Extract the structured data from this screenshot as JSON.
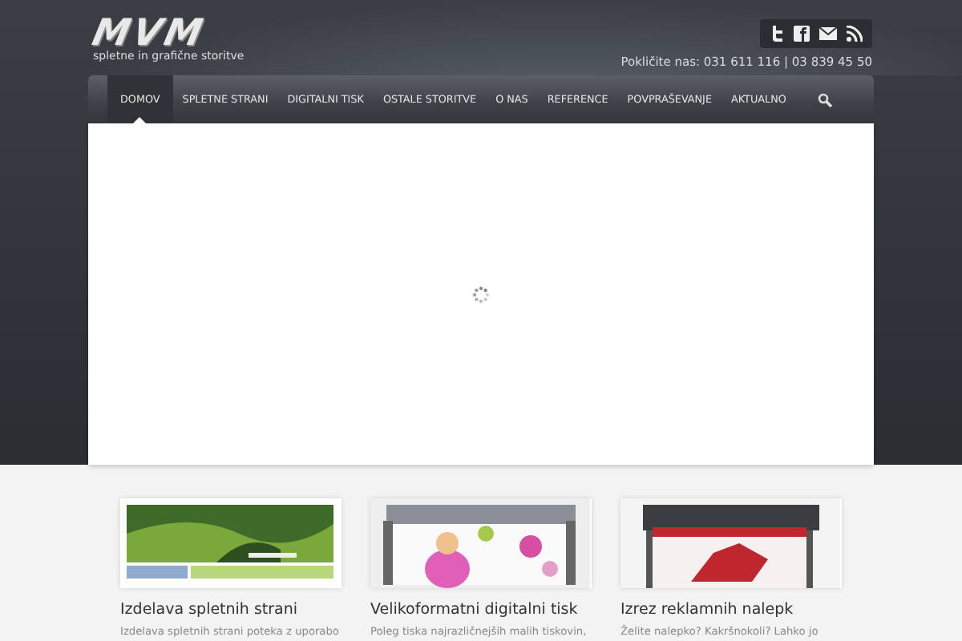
{
  "logo": {
    "text": "MVM",
    "tagline": "spletne in grafične storitve"
  },
  "contact": "Pokličite nas: 031 611 116 | 03 839 45 50",
  "nav": [
    {
      "label": "DOMOV",
      "selected": true
    },
    {
      "label": "SPLETNE STRANI",
      "selected": false
    },
    {
      "label": "DIGITALNI TISK",
      "selected": false
    },
    {
      "label": "OSTALE STORITVE",
      "selected": false
    },
    {
      "label": "O NAS",
      "selected": false
    },
    {
      "label": "REFERENCE",
      "selected": false
    },
    {
      "label": "POVPRAŠEVANJE",
      "selected": false
    },
    {
      "label": "AKTUALNO",
      "selected": false
    }
  ],
  "cards": [
    {
      "title": "Izdelava spletnih strani",
      "text": "Izdelava spletnih strani poteka z uporabo",
      "kind": "picture"
    },
    {
      "title": "Velikoformatni digitalni tisk",
      "text": "Poleg tiska najrazličnejših malih tiskovin,",
      "kind": "picture"
    },
    {
      "title": "Izrez reklamnih nalepk",
      "text": "Želite nalepko? Kakršnokoli? Lahko jo",
      "kind": "picture"
    }
  ]
}
